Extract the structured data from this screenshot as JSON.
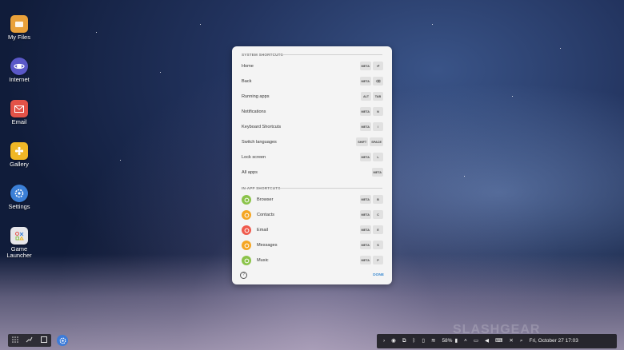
{
  "desktop": {
    "icons": [
      {
        "label": "My Files",
        "icon": "folder-icon",
        "color": "#e9a13a"
      },
      {
        "label": "Internet",
        "icon": "planet-icon",
        "color": "#5a58c8"
      },
      {
        "label": "Email",
        "icon": "mail-icon",
        "color": "#e35248"
      },
      {
        "label": "Gallery",
        "icon": "flower-icon",
        "color": "#f0b726"
      },
      {
        "label": "Settings",
        "icon": "gear-icon",
        "color": "#3b7fd6"
      },
      {
        "label": "Game Launcher",
        "icon": "gamepad-icon",
        "color": "#e6e6ea"
      }
    ]
  },
  "dialog": {
    "system_title": "SYSTEM SHORTCUTS",
    "system": [
      {
        "label": "Home",
        "keys": [
          "META",
          "⏎"
        ]
      },
      {
        "label": "Back",
        "keys": [
          "META",
          "⌫"
        ]
      },
      {
        "label": "Running apps",
        "keys": [
          "ALT",
          "TAB"
        ]
      },
      {
        "label": "Notifications",
        "keys": [
          "META",
          "N"
        ]
      },
      {
        "label": "Keyboard Shortcuts",
        "keys": [
          "META",
          "/"
        ]
      },
      {
        "label": "Switch languages",
        "keys": [
          "SHIFT",
          "SPACE"
        ]
      },
      {
        "label": "Lock screen",
        "keys": [
          "META",
          "L"
        ]
      },
      {
        "label": "All apps",
        "keys": [
          "META"
        ]
      }
    ],
    "inapp_title": "IN-APP SHORTCUTS",
    "inapp": [
      {
        "label": "Browser",
        "keys": [
          "META",
          "B"
        ],
        "color": "#8bc34a"
      },
      {
        "label": "Contacts",
        "keys": [
          "META",
          "C"
        ],
        "color": "#f5a623"
      },
      {
        "label": "Email",
        "keys": [
          "META",
          "E"
        ],
        "color": "#ef5a4c"
      },
      {
        "label": "Messages",
        "keys": [
          "META",
          "S"
        ],
        "color": "#f5a623"
      },
      {
        "label": "Music",
        "keys": [
          "META",
          "P"
        ],
        "color": "#8bc34a"
      }
    ],
    "help": "?",
    "done_label": "DONE"
  },
  "taskbar": {
    "battery": "58%",
    "datetime": "Fri, October 27  17:03"
  },
  "watermark": "SLASHGEAR"
}
